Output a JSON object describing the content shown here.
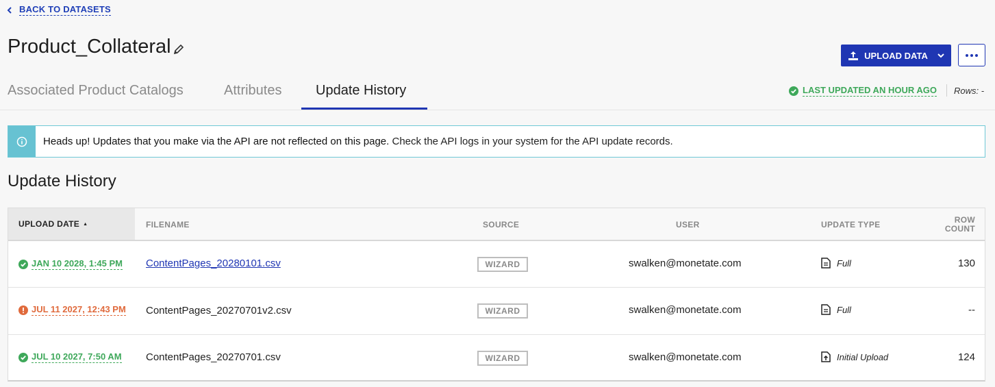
{
  "nav": {
    "back_label": "BACK TO DATASETS"
  },
  "page": {
    "title": "Product_Collateral"
  },
  "actions": {
    "upload_label": "UPLOAD DATA"
  },
  "tabs": [
    {
      "label": "Associated Product Catalogs"
    },
    {
      "label": "Attributes"
    },
    {
      "label": "Update History"
    }
  ],
  "status": {
    "last_updated": "LAST UPDATED AN HOUR AGO",
    "rows": "Rows: -"
  },
  "alert": {
    "bold": "Heads up! Updates that you make via the API are not reflected on this page.",
    "rest": " Check the API logs in your system for the API update records."
  },
  "section": {
    "title": "Update History"
  },
  "table": {
    "headers": {
      "upload_date": "UPLOAD DATE",
      "filename": "FILENAME",
      "source": "SOURCE",
      "user": "USER",
      "update_type": "UPDATE TYPE",
      "row_count_1": "ROW",
      "row_count_2": "COUNT"
    },
    "rows": [
      {
        "date": "JAN 10 2028, 1:45 PM",
        "status": "success",
        "filename": "ContentPages_20280101.csv",
        "source": "WIZARD",
        "user": "swalken@monetate.com",
        "update_type": "Full",
        "row_count": "130"
      },
      {
        "date": "JUL 11 2027, 12:43 PM",
        "status": "error",
        "filename": "ContentPages_20270701v2.csv",
        "source": "WIZARD",
        "user": "swalken@monetate.com",
        "update_type": "Full",
        "row_count": "--"
      },
      {
        "date": "JUL 10 2027, 7:50 AM",
        "status": "success",
        "filename": "ContentPages_20270701.csv",
        "source": "WIZARD",
        "user": "swalken@monetate.com",
        "update_type": "Initial Upload",
        "row_count": "124"
      }
    ]
  },
  "colors": {
    "primary": "#1f36b3",
    "success": "#3ea85a",
    "error": "#e06a3c",
    "info": "#67c2d2"
  }
}
